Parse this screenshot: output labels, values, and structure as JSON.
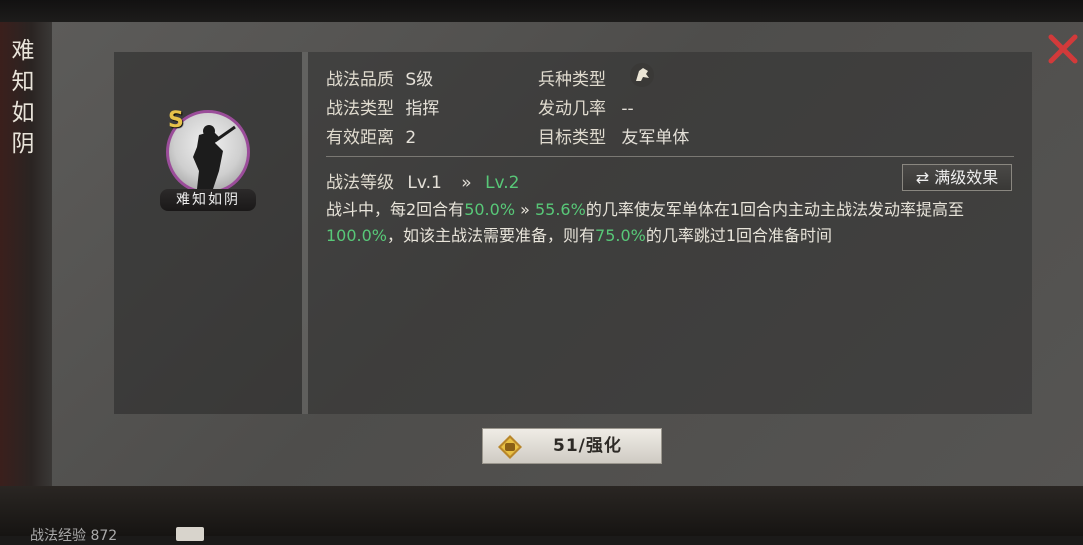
{
  "skill": {
    "title": "难知如阴",
    "name_ribbon": "难知如阴",
    "grade_badge": "S"
  },
  "attributes": {
    "quality_label": "战法品质",
    "quality_value": "S级",
    "type_label": "战法类型",
    "type_value": "指挥",
    "range_label": "有效距离",
    "range_value": "2",
    "troop_label": "兵种类型",
    "rate_label": "发动几率",
    "rate_value": "--",
    "target_label": "目标类型",
    "target_value": "友军单体"
  },
  "level": {
    "label": "战法等级",
    "current": "Lv.1",
    "arrow": "»",
    "next": "Lv.2",
    "full_effect_button": "满级效果"
  },
  "description": {
    "p1": "战斗中，每2回合有",
    "v1": "50.0%",
    "arrow": " » ",
    "v2": "55.6%",
    "p2": "的几率使友军单体在1回合内主动主战法发动率提高至",
    "v3": "100.0%",
    "p3": "，如该主战法需要准备，则有",
    "v4": "75.0%",
    "p4": "的几率跳过1回合准备时间"
  },
  "strengthen": {
    "label": "51/强化"
  },
  "bottom": {
    "text": "战法经验 872"
  },
  "colors": {
    "highlight_green": "#58c878",
    "grade_gold": "#e6c24a",
    "portrait_ring": "#9b4d9a",
    "close_red": "#d23a3a"
  }
}
